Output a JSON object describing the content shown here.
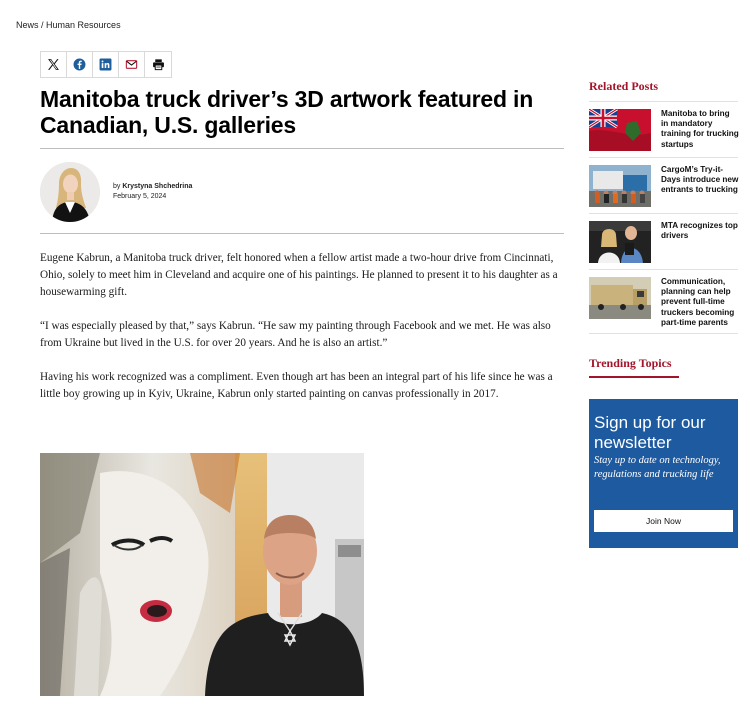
{
  "breadcrumb": {
    "parent": "News",
    "separator": " / ",
    "current": "Human Resources"
  },
  "share_icons": [
    "x-icon",
    "facebook-icon",
    "linkedin-icon",
    "mail-icon",
    "print-icon"
  ],
  "article": {
    "title": "Manitoba truck driver’s 3D artwork featured in Canadian, U.S. galleries",
    "author_prefix": "by ",
    "author": "Krystyna Shchedrina",
    "date": "February 5, 2024",
    "paragraphs": [
      "Eugene Kabrun, a Manitoba truck driver, felt honored when a fellow artist made a two-hour drive from Cincinnati, Ohio, solely to meet him in Cleveland and acquire one of his paintings. He planned to present it to his daughter as a housewarming gift.",
      "“I was especially pleased by that,” says Kabrun. “He saw my painting through Facebook and we met. He was also from Ukraine but lived in the U.S. for over 20 years. And he is also an artist.”",
      "Having his work recognized was a compliment. Even though art has been an integral part of his life since he was a little boy growing up in Kyiv, Ukraine, Kabrun only started painting on canvas professionally in 2017."
    ]
  },
  "sidebar": {
    "related_title": "Related Posts",
    "posts": [
      {
        "title": "Manitoba to bring in mandatory training for trucking startups"
      },
      {
        "title": "CargoM’s Try-it-Days introduce new entrants to trucking"
      },
      {
        "title": "MTA recognizes top drivers"
      },
      {
        "title": "Communication, planning can help prevent full-time truckers becoming part-time parents"
      }
    ],
    "trending_title": "Trending Topics",
    "newsletter": {
      "title": "Sign up for our newsletter",
      "subtitle": "Stay up to date on technology, regulations and trucking life",
      "button": "Join Now"
    }
  },
  "colors": {
    "accent": "#a3142a",
    "newsletter_bg": "#1e5aa0"
  }
}
